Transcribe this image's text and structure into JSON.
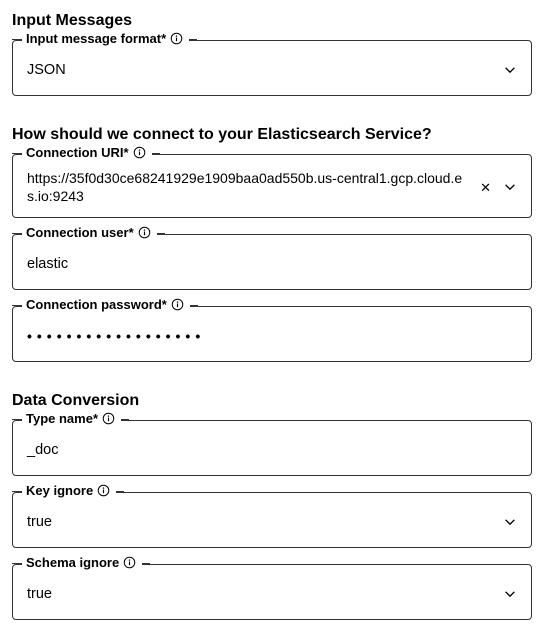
{
  "sections": {
    "input": {
      "title": "Input Messages",
      "format": {
        "label": "Input message format*",
        "value": "JSON"
      }
    },
    "connect": {
      "title": "How should we connect to your Elasticsearch Service?",
      "uri": {
        "label": "Connection URI*",
        "value": "https://35f0d30ce68241929e1909baa0ad550b.us-central1.gcp.cloud.es.io:9243"
      },
      "user": {
        "label": "Connection user*",
        "value": "elastic"
      },
      "password": {
        "label": "Connection password*",
        "masked": "••••••••••••••••••"
      }
    },
    "conversion": {
      "title": "Data Conversion",
      "type_name": {
        "label": "Type name*",
        "value": "_doc"
      },
      "key_ignore": {
        "label": "Key ignore",
        "value": "true"
      },
      "schema_ignore": {
        "label": "Schema ignore",
        "value": "true"
      }
    }
  }
}
